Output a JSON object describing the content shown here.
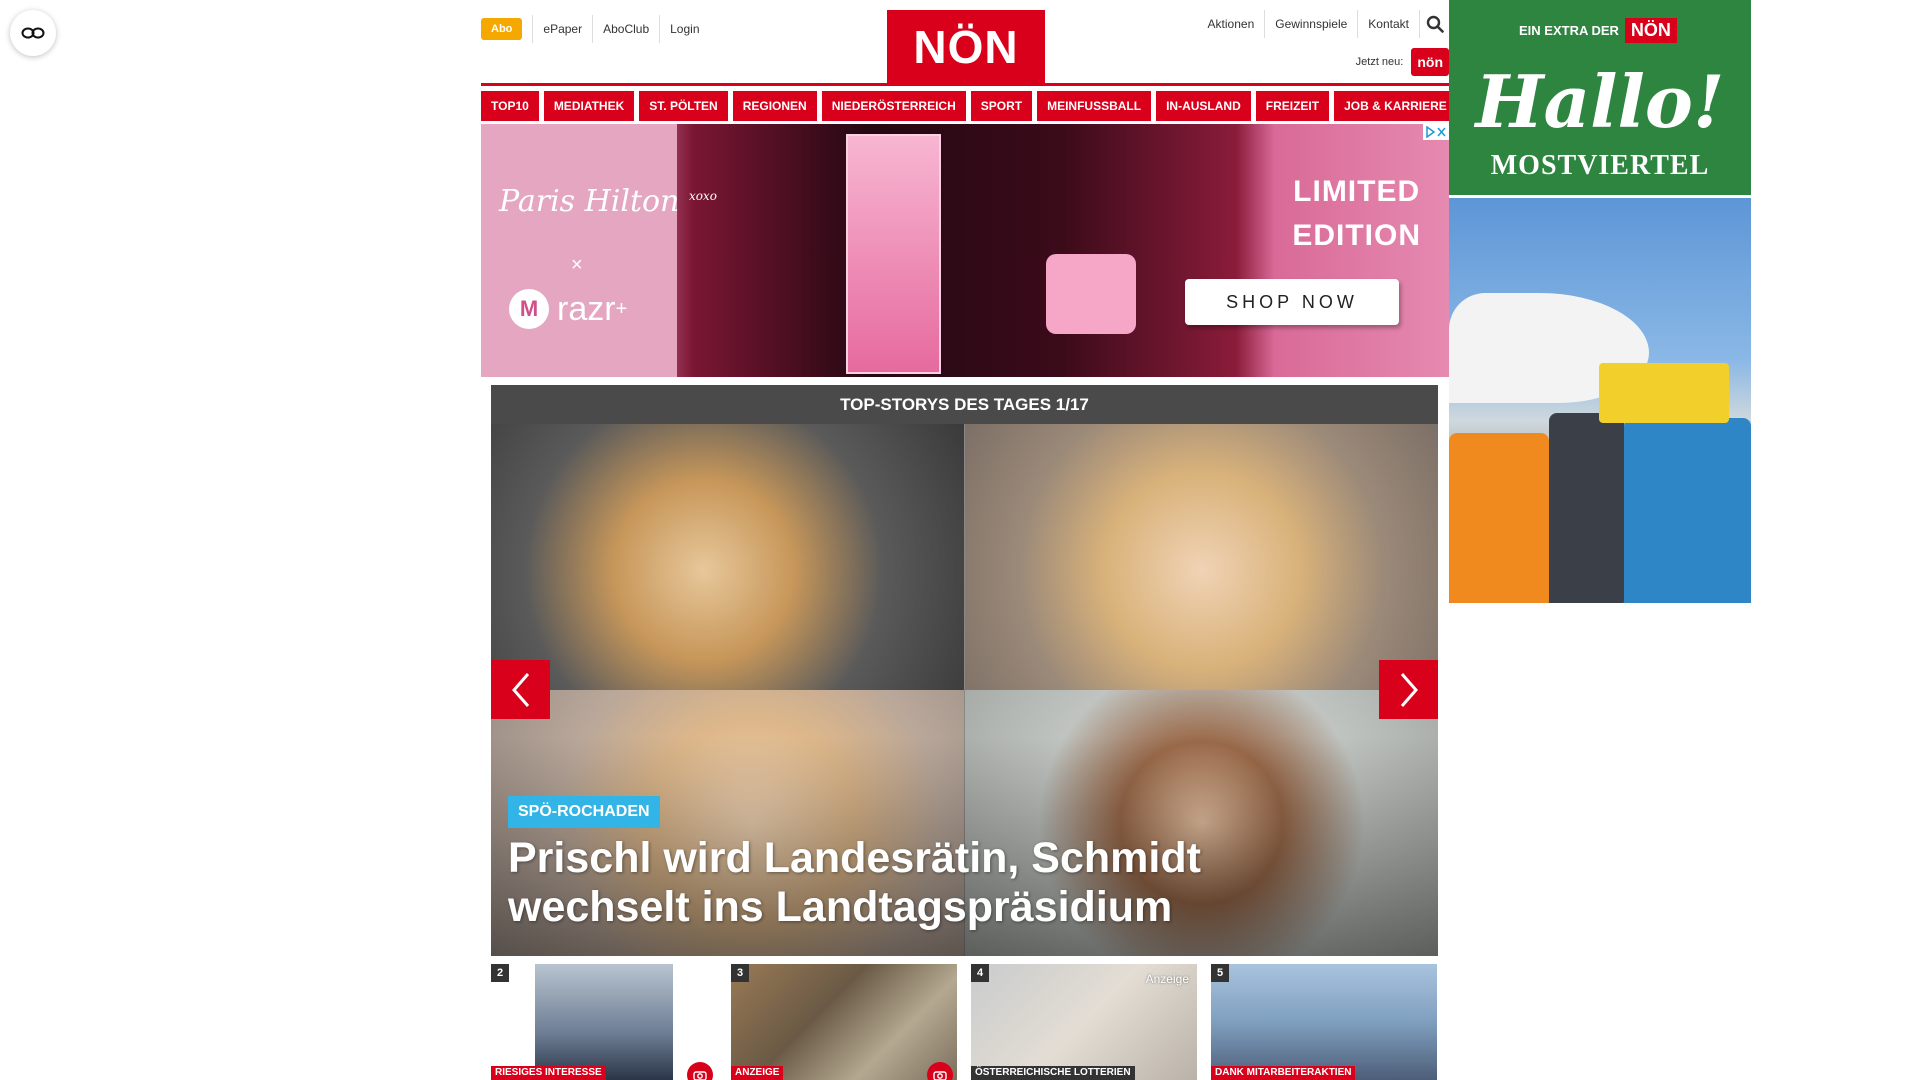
{
  "header": {
    "abo_label": "Abo",
    "left_links": [
      "ePaper",
      "AboClub",
      "Login"
    ],
    "logo_text": "NÖN",
    "right_links": [
      "Aktionen",
      "Gewinnspiele",
      "Kontakt"
    ],
    "jetzt_label": "Jetzt neu:",
    "jetzt_badge": "nön"
  },
  "nav": {
    "items": [
      "TOP10",
      "MEDIATHEK",
      "ST. PÖLTEN",
      "REGIONEN",
      "NIEDERÖSTERREICH",
      "SPORT",
      "MEINFUSSBALL",
      "IN-AUSLAND",
      "FREIZEIT",
      "JOB & KARRIERE"
    ]
  },
  "ad": {
    "brand": "Paris Hilton",
    "brand_suffix": "xoxo",
    "x": "×",
    "partner": "razr",
    "partner_plus": "+",
    "headline_1": "LIMITED",
    "headline_2": "EDITION",
    "cta": "SHOP NOW"
  },
  "top_stories": {
    "header": "TOP-STORYS DES TAGES 1/17",
    "hero_tag": "SPÖ-ROCHADEN",
    "hero_title": "Prischl wird Landesrätin, Schmidt wechselt ins Landtagspräsidium",
    "teasers": [
      {
        "num": "2",
        "label": "RIESIGES INTERESSE",
        "label_color": "#d8001a",
        "anzeige": ""
      },
      {
        "num": "3",
        "label": "ANZEIGE",
        "label_color": "#d8001a",
        "anzeige": ""
      },
      {
        "num": "4",
        "label": "ÖSTERREICHISCHE LOTTERIEN",
        "label_color": "#333333",
        "anzeige": "Anzeige"
      },
      {
        "num": "5",
        "label": "DANK MITARBEITERAKTIEN",
        "label_color": "#d8001a",
        "anzeige": ""
      }
    ]
  },
  "side_ad": {
    "extra_label": "EIN EXTRA DER",
    "extra_logo": "NÖN",
    "hallo": "Hallo!",
    "region": "MOSTVIERTEL"
  },
  "colors": {
    "brand_red": "#d8001a",
    "abo_orange": "#f5a800",
    "tag_blue": "#32b4e6",
    "side_green": "#2e8540"
  }
}
